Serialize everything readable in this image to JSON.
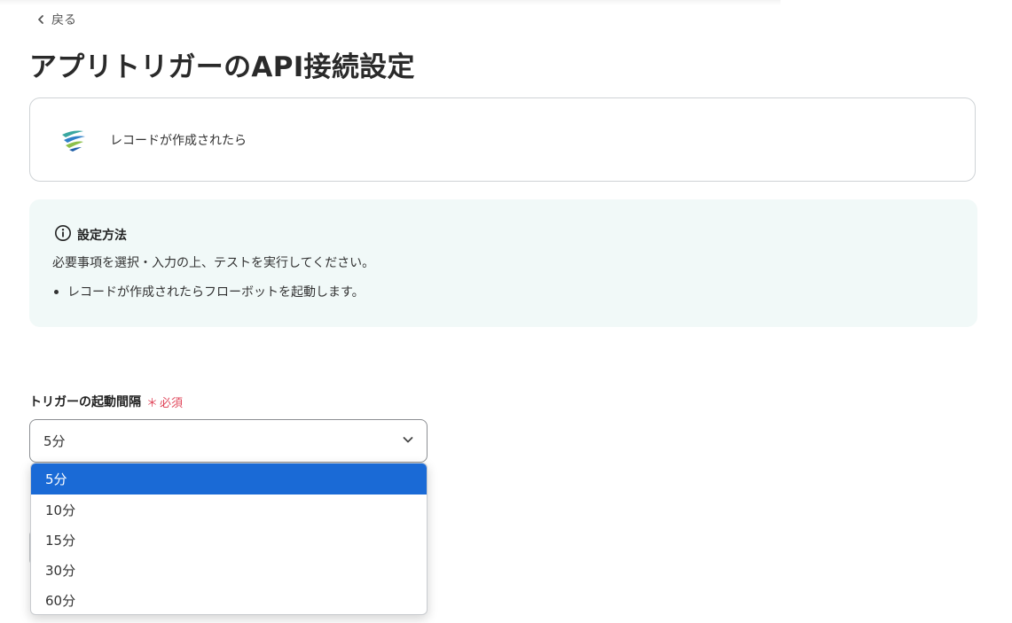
{
  "nav": {
    "back_label": "戻る"
  },
  "page": {
    "title": "アプリトリガーのAPI接続設定"
  },
  "app_card": {
    "trigger_label": "レコードが作成されたら",
    "logo_icon": "app-logo-icon"
  },
  "info": {
    "heading": "設定方法",
    "description": "必要事項を選択・入力の上、テストを実行してください。",
    "bullets": [
      "レコードが作成されたらフローボットを起動します。"
    ]
  },
  "interval_field": {
    "label": "トリガーの起動間隔",
    "required_mark": "＊",
    "required_label": "必須",
    "selected_value": "5分",
    "options": [
      "5分",
      "10分",
      "15分",
      "30分",
      "60分"
    ]
  },
  "colors": {
    "accent": "#1a6ad6",
    "required": "#e0475b",
    "info_bg": "#f1f9f8"
  }
}
